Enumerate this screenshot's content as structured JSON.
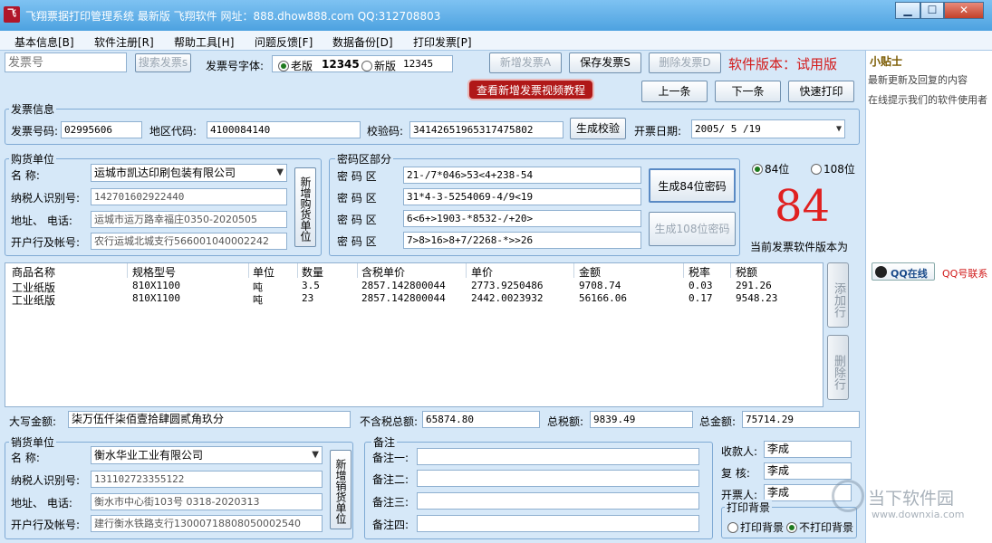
{
  "titlebar": {
    "logo": "飞",
    "title": "飞翔票据打印管理系统  最新版 飞翔软件 网址：888.dhow888.com QQ:312708803"
  },
  "window": {
    "minimize": "▁",
    "maximize": "☐",
    "close": "✕"
  },
  "menu": [
    "基本信息[B]",
    "软件注册[R]",
    "帮助工具[H]",
    "问题反馈[F]",
    "数据备份[D]",
    "打印发票[P]"
  ],
  "toolbar": {
    "search_placeholder": "发票号",
    "search_btn": "搜索发票s",
    "font_label": "发票号字体:",
    "old_label": "老版",
    "old_sample": "12345",
    "new_label": "新版",
    "new_sample": "12345",
    "new_invoice": "新增发票A",
    "save_invoice": "保存发票S",
    "delete_invoice": "删除发票D",
    "version": "软件版本：试用版",
    "video": "查看新增发票视频教程",
    "prev": "上一条",
    "next": "下一条",
    "quick_print": "快速打印"
  },
  "invoice_info": {
    "title": "发票信息",
    "no_label": "发票号码:",
    "no": "02995606",
    "area_label": "地区代码:",
    "area": "4100084140",
    "check_label": "校验码:",
    "check": "34142651965317475802",
    "gen_check": "生成校验",
    "date_label": "开票日期:",
    "date": "2005/ 5 /19"
  },
  "buyer": {
    "title": "购货单位",
    "name_label": "名      称:",
    "name": "运城市凯达印刷包装有限公司",
    "tax_label": "纳税人识别号:",
    "tax": "142701602922440",
    "addr_label": "地址、 电话:",
    "addr": "运城市运万路幸福庄0350-2020505",
    "bank_label": "开户行及帐号:",
    "bank": "农行运城北城支行566001040002242",
    "add_btn": "新增购货单位"
  },
  "password": {
    "title": "密码区部分",
    "label": "密  码  区",
    "rows": [
      "21-/7*046>53<4+238-54",
      "31*4-3-5254069-4/9<19",
      "6<6+>1903-*8532-/+20>",
      "7>8>16>8+7/2268-*>>26"
    ],
    "gen84": "生成84位密码",
    "gen108": "生成108位密码"
  },
  "version_select": {
    "opt84": "84位",
    "opt108": "108位",
    "big": "84",
    "caption": "当前发票软件版本为"
  },
  "items": {
    "headers": [
      "商品名称",
      "规格型号",
      "单位",
      "数量",
      "含税单价",
      "单价",
      "金额",
      "税率",
      "税额"
    ],
    "rows": [
      [
        "工业纸版",
        "810X1100",
        "吨",
        "3.5",
        "2857.142800044",
        "2773.9250486",
        "9708.74",
        "0.03",
        "291.26"
      ],
      [
        "工业纸版",
        "810X1100",
        "吨",
        "23",
        "2857.142800044",
        "2442.0023932",
        "56166.06",
        "0.17",
        "9548.23"
      ]
    ],
    "add_row": "添加行",
    "del_row": "删除行"
  },
  "totals": {
    "upper_label": "大写金额:",
    "upper": "柒万伍仟柒佰壹拾肆圆贰角玖分",
    "notax_label": "不含税总额:",
    "notax": "65874.80",
    "tax_label": "总税额:",
    "tax": "9839.49",
    "total_label": "总金额:",
    "total": "75714.29"
  },
  "seller": {
    "title": "销货单位",
    "name_label": "名      称:",
    "name": "衡水华业工业有限公司",
    "tax_label": "纳税人识别号:",
    "tax": "131102723355122",
    "addr_label": "地址、 电话:",
    "addr": "衡水市中心街103号 0318-2020313",
    "bank_label": "开户行及帐号:",
    "bank": "建行衡水铁路支行13000718808050002540",
    "add_btn": "新增销货单位"
  },
  "remarks": {
    "title": "备注",
    "labels": [
      "备注一:",
      "备注二:",
      "备注三:",
      "备注四:"
    ]
  },
  "people": {
    "payee_label": "收款人:",
    "payee": "李成",
    "review_label": "复  核:",
    "review": "李成",
    "drawer_label": "开票人:",
    "drawer": "李成"
  },
  "print_bg": {
    "title": "打印背景",
    "opt_print": "打印背景",
    "opt_noprint": "不打印背景"
  },
  "sidebar": {
    "title": "小贴士",
    "line1": "最新更新及回复的内容",
    "line2": "在线提示我们的软件使用者",
    "qq_btn": "QQ在线",
    "qq_contact": "QQ号联系"
  },
  "watermark": {
    "text1": "当下软件园",
    "text2": "www.downxia.com"
  }
}
